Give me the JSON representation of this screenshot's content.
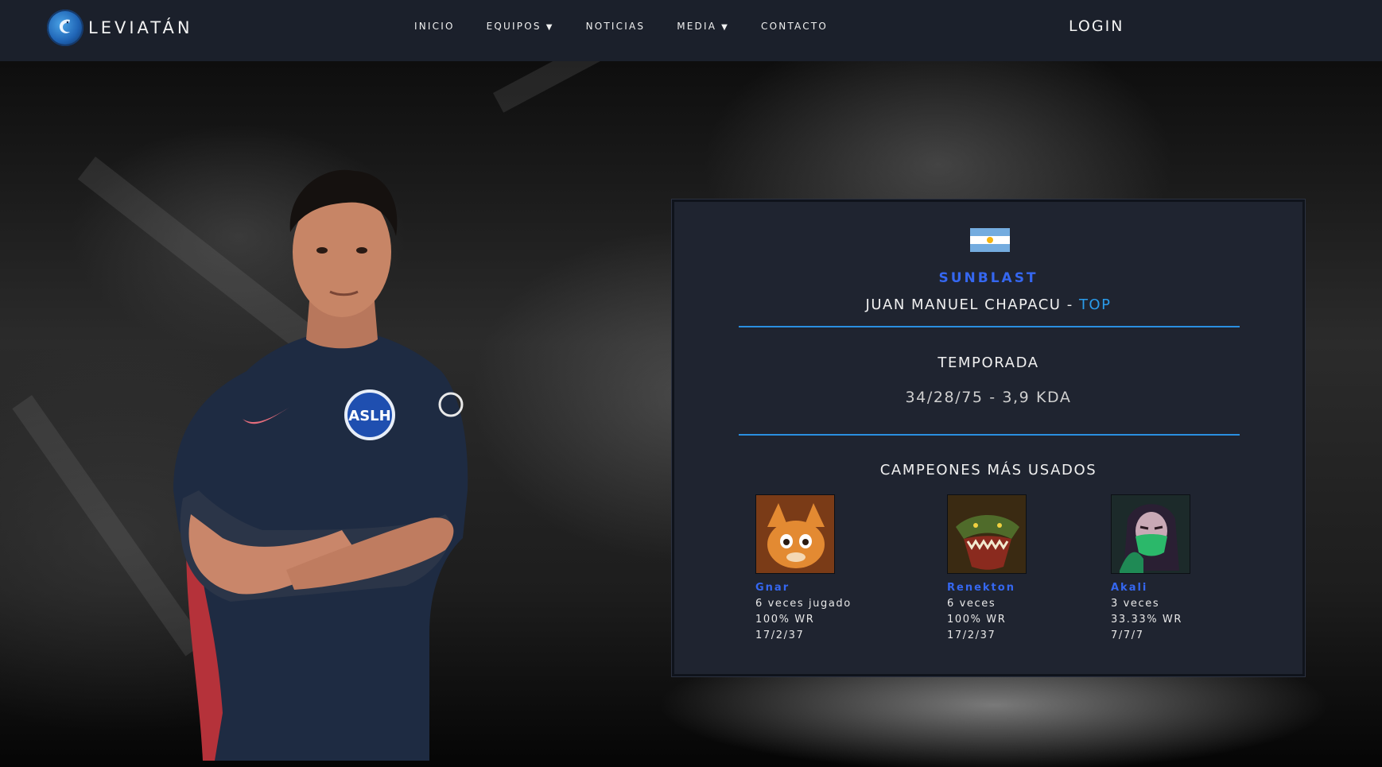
{
  "nav": {
    "brand": "LEVIATÁN",
    "links": [
      {
        "label": "INICIO",
        "has_dropdown": false
      },
      {
        "label": "EQUIPOS",
        "has_dropdown": true
      },
      {
        "label": "NOTICIAS",
        "has_dropdown": false
      },
      {
        "label": "MEDIA",
        "has_dropdown": true
      },
      {
        "label": "CONTACTO",
        "has_dropdown": false
      }
    ],
    "caret": "▼",
    "login": "LOGIN"
  },
  "player": {
    "flag": "flag-argentina-icon",
    "nickname": "SUNBLAST",
    "full_name": "JUAN MANUEL CHAPACU",
    "separator": " - ",
    "role": "TOP"
  },
  "season": {
    "title": "TEMPORADA",
    "stats": "34/28/75 - 3,9 KDA"
  },
  "champions": {
    "title": "CAMPEONES MÁS USADOS",
    "items": [
      {
        "name": "Gnar",
        "games": "6 veces jugado",
        "winrate": "100% WR",
        "kda": "17/2/37",
        "icon": "gnar-portrait"
      },
      {
        "name": "Renekton",
        "games": "6 veces",
        "winrate": "100% WR",
        "kda": "17/2/37",
        "icon": "renekton-portrait"
      },
      {
        "name": "Akali",
        "games": "3 veces",
        "winrate": "33.33% WR",
        "kda": "7/7/7",
        "icon": "akali-portrait"
      }
    ]
  },
  "colors": {
    "navbar": "#1b202b",
    "card": "#1f2430",
    "accent_blue": "#3567f0",
    "role_blue": "#2a9bea",
    "divider": "#2a8fe0"
  }
}
